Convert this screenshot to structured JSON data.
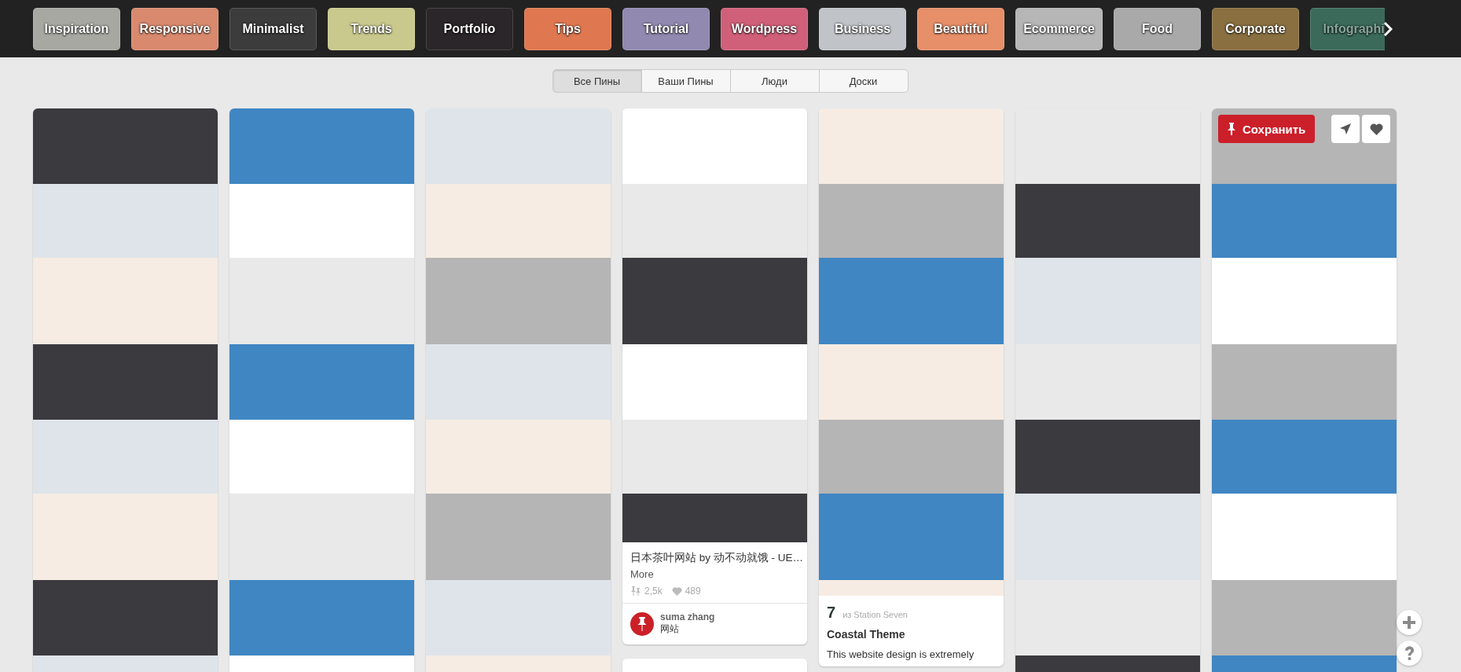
{
  "categories": [
    {
      "label": "Inspiration",
      "color": "#a8a8a2"
    },
    {
      "label": "Responsive",
      "color": "#d98a6e"
    },
    {
      "label": "Minimalist",
      "color": "#3c3c3c"
    },
    {
      "label": "Trends",
      "color": "#c9c98e"
    },
    {
      "label": "Portfolio",
      "color": "#2b2629"
    },
    {
      "label": "Tips",
      "color": "#df7850"
    },
    {
      "label": "Tutorial",
      "color": "#9189b0"
    },
    {
      "label": "Wordpress",
      "color": "#d06079"
    },
    {
      "label": "Business",
      "color": "#c0c4c8"
    },
    {
      "label": "Beautiful",
      "color": "#e78f69"
    },
    {
      "label": "Ecommerce",
      "color": "#b6b6b6"
    },
    {
      "label": "Food",
      "color": "#a9a9a9"
    },
    {
      "label": "Corporate",
      "color": "#8a7040"
    },
    {
      "label": "Infographi",
      "color": "#3b6a5b"
    }
  ],
  "tabs": [
    {
      "label": "Все Пины",
      "selected": true
    },
    {
      "label": "Ваши Пины",
      "selected": false
    },
    {
      "label": "Люди",
      "selected": false
    },
    {
      "label": "Доски",
      "selected": false
    }
  ],
  "columns": [
    {
      "pins": [
        {
          "kind": "image"
        }
      ]
    },
    {
      "pins": [
        {
          "kind": "image"
        }
      ]
    },
    {
      "pins": [
        {
          "kind": "image"
        }
      ]
    },
    {
      "pins": [
        {
          "kind": "described",
          "title": "日本茶叶网站 by 动不动就饿 - UE…",
          "more": "More",
          "repins": "2,5k",
          "likes": "489",
          "user": "suma zhang",
          "board": "网站"
        },
        {
          "kind": "image"
        }
      ]
    },
    {
      "pins": [
        {
          "kind": "sourced",
          "count": "7",
          "source": "из Station Seven",
          "title": "Coastal Theme",
          "description": "This website design is extremely"
        }
      ]
    },
    {
      "pins": [
        {
          "kind": "image"
        }
      ]
    },
    {
      "pins": [
        {
          "kind": "hovered",
          "save": "Сохранить"
        }
      ]
    }
  ]
}
